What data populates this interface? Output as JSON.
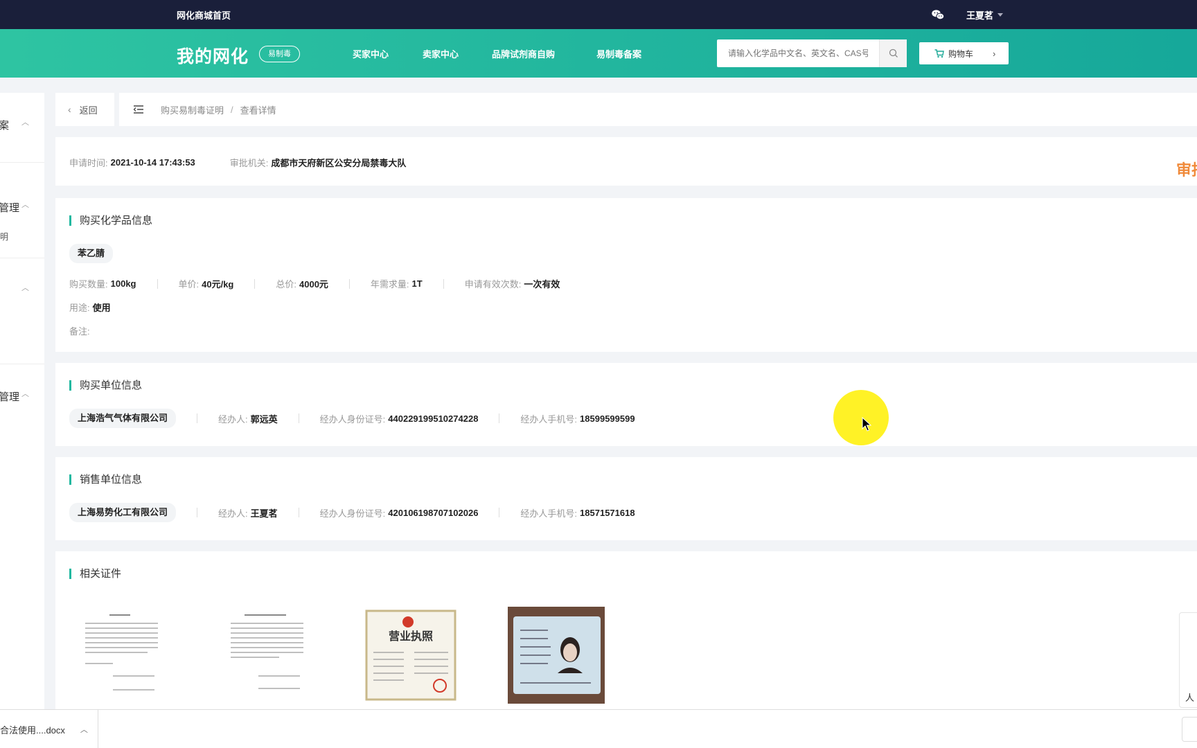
{
  "topbar": {
    "home_link": "网化商城首页",
    "username": "王夏茗"
  },
  "header": {
    "brand": "我的网化",
    "badge": "易制毒",
    "nav": [
      "买家中心",
      "卖家中心",
      "品牌试剂商自购",
      "易制毒备案"
    ],
    "search_placeholder": "请输入化学品中文名、英文名、CAS号",
    "cart_label": "购物车"
  },
  "sidebar": {
    "items": [
      "案",
      "管理",
      "明",
      "管理"
    ]
  },
  "breadcrumb": {
    "back_label": "返回",
    "path": [
      "购买易制毒证明",
      "查看详情"
    ]
  },
  "application": {
    "time_label": "申请时间:",
    "time_value": "2021-10-14 17:43:53",
    "authority_label": "审批机关:",
    "authority_value": "成都市天府新区公安分局禁毒大队",
    "status": "审批"
  },
  "chemical": {
    "title": "购买化学品信息",
    "name": "苯乙腈",
    "fields": [
      {
        "label": "购买数量:",
        "value": "100kg"
      },
      {
        "label": "单价:",
        "value": "40元/kg"
      },
      {
        "label": "总价:",
        "value": "4000元"
      },
      {
        "label": "年需求量:",
        "value": "1T"
      },
      {
        "label": "申请有效次数:",
        "value": "一次有效"
      }
    ],
    "usage_label": "用途:",
    "usage_value": "使用",
    "remark_label": "备注:",
    "remark_value": ""
  },
  "buyer": {
    "title": "购买单位信息",
    "company": "上海浩气气体有限公司",
    "agent_label": "经办人:",
    "agent_value": "郭远英",
    "id_label": "经办人身份证号:",
    "id_value": "440229199510274228",
    "phone_label": "经办人手机号:",
    "phone_value": "18599599599"
  },
  "seller": {
    "title": "销售单位信息",
    "company": "上海易势化工有限公司",
    "agent_label": "经办人:",
    "agent_value": "王夏茗",
    "id_label": "经办人身份证号:",
    "id_value": "420106198707102026",
    "phone_label": "经办人手机号:",
    "phone_value": "18571571618"
  },
  "documents": {
    "title": "相关证件",
    "items": [
      {
        "icon": "document-page-icon"
      },
      {
        "icon": "document-page-icon"
      },
      {
        "icon": "business-license-icon"
      },
      {
        "icon": "id-card-icon"
      }
    ]
  },
  "download_bar": {
    "file_name": "合法使用....docx"
  },
  "float_panel": {
    "label": "人"
  }
}
